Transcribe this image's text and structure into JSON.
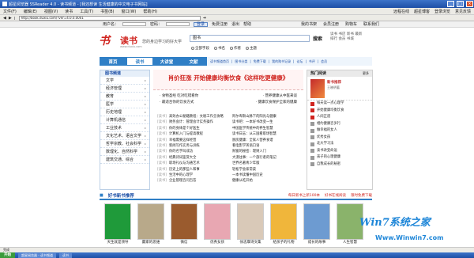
{
  "window": {
    "title": "超星阅览器 SSReader 4.0 - 读书频道 - [我还想读 生活健康的中文电子书网站]"
  },
  "menu": [
    "文件(F)",
    "编辑(E)",
    "视图(V)",
    "读书",
    "工具(T)",
    "书签(B)",
    "窗口(W)",
    "帮助(H)"
  ],
  "menu_right": [
    "远程在线",
    "超星博客",
    "登录浏览",
    "意见反馈"
  ],
  "address": "http://book.duxiu.com/?ver=4.0.0.0001",
  "site": {
    "user_label": "用户名：",
    "pwd_label": "密码：",
    "login": "登录",
    "register": "免费注册",
    "logout": "退出",
    "help": "帮助",
    "right_links": [
      "我的书架",
      "会员注册",
      "购物车",
      "联系我们"
    ]
  },
  "logo": {
    "mark": "书",
    "name": "读书",
    "slogan": "您的身边学习的好大学",
    "url": "www.duxiu.com"
  },
  "search": {
    "placeholder": "图书",
    "button": "搜索",
    "options": [
      "全部字段",
      "书名",
      "作者",
      "主题"
    ]
  },
  "toplinks": [
    "读书",
    "书店",
    "新书",
    "最新",
    "排行",
    "会员",
    "书城"
  ],
  "nav": {
    "tabs": [
      "首页",
      "读书",
      "大讲堂",
      "文献"
    ],
    "links": [
      "读书频道首页",
      "图书分类",
      "免费下载",
      "我的购书记录",
      "论坛",
      "书评",
      "会员"
    ]
  },
  "left": {
    "title": "图书频道",
    "categories": [
      "文学",
      "经济管理",
      "教育",
      "医学",
      "历史地理",
      "计算机通信",
      "工业技术",
      "文化艺术、语言文学",
      "哲学宗教、社会科学",
      "数理化、自然科学",
      "建筑交通、综合"
    ]
  },
  "center": {
    "banner": "肖价狂涨  开始健康均衡饮食《这样吃更健康》",
    "hot": [
      [
        "· 食物圣经 吃对吃错看你",
        "· 营养健康从中医来谈"
      ],
      [
        "· 最适合你的饮食方式",
        "· 健康饮食保护全家的健康"
      ]
    ],
    "list": [
      {
        "tag": "[读书]",
        "a": "高效办公秘籍教程：文秘工作全攻略",
        "b": "阿尔卑斯山脉下的阳光与健康"
      },
      {
        "tag": "[读书]",
        "a": "财务会计：管理会计实务操作",
        "b": "读书吧：一本好书改变一生"
      },
      {
        "tag": "[读书]",
        "a": "你的身体是个好医生",
        "b": "中国医学传统中的养生智慧"
      },
      {
        "tag": "[读书]",
        "a": "计算机入门与提高教程",
        "b": "读书日志：从三国看职场智慧"
      },
      {
        "tag": "[读书]",
        "a": "幸福需要这样经营",
        "b": "厨房健康：全家人营养食谱"
      },
      {
        "tag": "[读书]",
        "a": "新闻写作实务与训练",
        "b": "看电影学英语口语"
      },
      {
        "tag": "[读书]",
        "a": "你的名字叫成功",
        "b": "财富的秘密：理财入门"
      },
      {
        "tag": "[读书]",
        "a": "经典诗词鉴赏大全",
        "b": "大漠往事：一个旅行者的笔记"
      },
      {
        "tag": "[读书]",
        "a": "职场礼仪与沟通艺术",
        "b": "世界名著青少年版"
      },
      {
        "tag": "[读书]",
        "a": "历史上的那些人和事",
        "b": "轻松学会家常菜"
      },
      {
        "tag": "[读书]",
        "a": "生活中的心理学",
        "b": "一本书读懂中国历史"
      },
      {
        "tag": "[读书]",
        "a": "企业管理百问百答",
        "b": "健康从吃开始"
      }
    ]
  },
  "right": {
    "title": "热门阅读",
    "more": "更多",
    "featured": {
      "title": "新书推荐",
      "subtitle": "王晓明著"
    },
    "ranks": [
      "每天读一点心理学",
      "开始健康均衡饮食",
      "人间正道",
      "相约健康百岁行",
      "做幸福的女人",
      "优秀女孩",
      "北大学习法",
      "读书改变命运",
      "孩子的心理健康",
      "自我成长的秘密"
    ]
  },
  "shelf": {
    "title": "好书新书推荐",
    "more": [
      "每日新书上新100本",
      "好书在线阅读",
      "限时免费下载"
    ],
    "books": [
      "天生就是领导",
      "赢家的思维",
      "微信",
      "优秀女孩",
      "徐志摩诗文集",
      "给孩子的礼物",
      "成长的故事",
      "人生智慧"
    ]
  },
  "status": "完成",
  "taskbar": {
    "start": "开始",
    "tasks": [
      "超星阅览器 - 读书频道",
      "读书"
    ]
  },
  "watermark": {
    "text": "Win7系统之家",
    "url": "Www.Winwin7.com"
  }
}
